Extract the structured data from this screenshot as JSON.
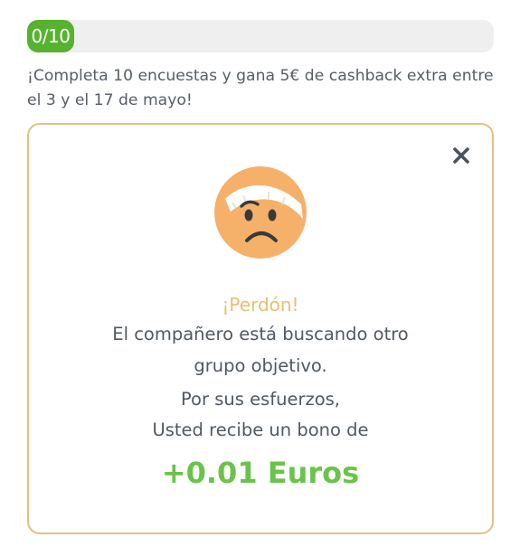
{
  "progress": {
    "label": "0/10",
    "completed": 0,
    "total": 10,
    "fill_color": "#56b22f"
  },
  "promo": {
    "text": "¡Completa 10 encuestas y gana 5€ de cashback extra entre el 3 y el 17 de mayo!"
  },
  "card": {
    "border_color": "#e2c17f",
    "close_icon": "close-icon",
    "emoji_icon": "injured-face-icon",
    "title": "¡Perdón!",
    "message_line1": "El compañero está buscando otro",
    "message_line2": "grupo objetivo.",
    "reward_line1": "Por sus esfuerzos,",
    "reward_line2": "Usted recibe un bono de",
    "bonus": "+0.01 Euros",
    "title_color": "#e6bf71",
    "bonus_color": "#6ac34a"
  }
}
